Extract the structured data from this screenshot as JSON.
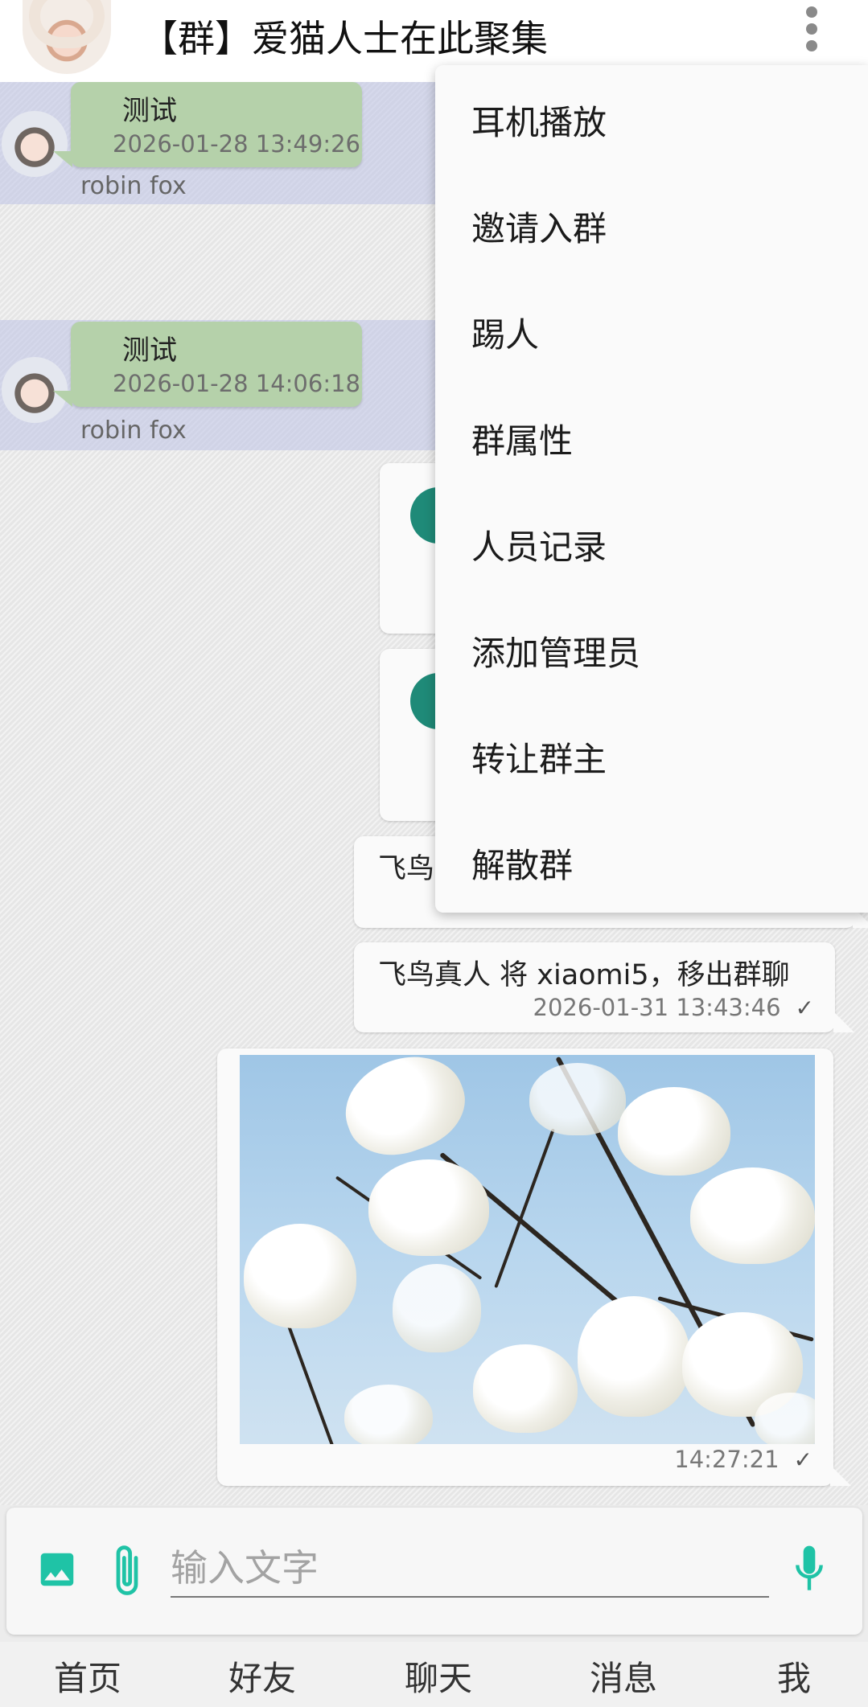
{
  "header": {
    "title": "【群】爱猫人士在此聚集"
  },
  "messages_in": [
    {
      "text": "测试",
      "time": "2026-01-28 13:49:26",
      "sender": "robin fox"
    },
    {
      "text": "测试",
      "time": "2026-01-28 14:06:18",
      "sender": "robin fox"
    }
  ],
  "messages_out": [
    {
      "text": "飞鸟",
      "time": ""
    },
    {
      "text": "飞鸟真人 将 xiaomi5，移出群聊",
      "time": "2026-01-31 13:43:46",
      "status": "✓"
    },
    {
      "kind": "image",
      "time": "14:27:21",
      "status": "✓"
    }
  ],
  "menu": {
    "items": [
      "耳机播放",
      "邀请入群",
      "踢人",
      "群属性",
      "人员记录",
      "添加管理员",
      "转让群主",
      "解散群"
    ]
  },
  "input": {
    "placeholder": "输入文字"
  },
  "nav": {
    "tabs": [
      "首页",
      "好友",
      "聊天",
      "消息",
      "我"
    ]
  },
  "colors": {
    "accent": "#1fc3a6",
    "incoming_bubble": "#b5d1aa",
    "incoming_row": "#c9cce8",
    "teal": "#1f8a78"
  },
  "icons": {
    "image": "image-icon",
    "attach": "paperclip-icon",
    "mic": "microphone-icon",
    "more": "more-vertical-icon"
  }
}
